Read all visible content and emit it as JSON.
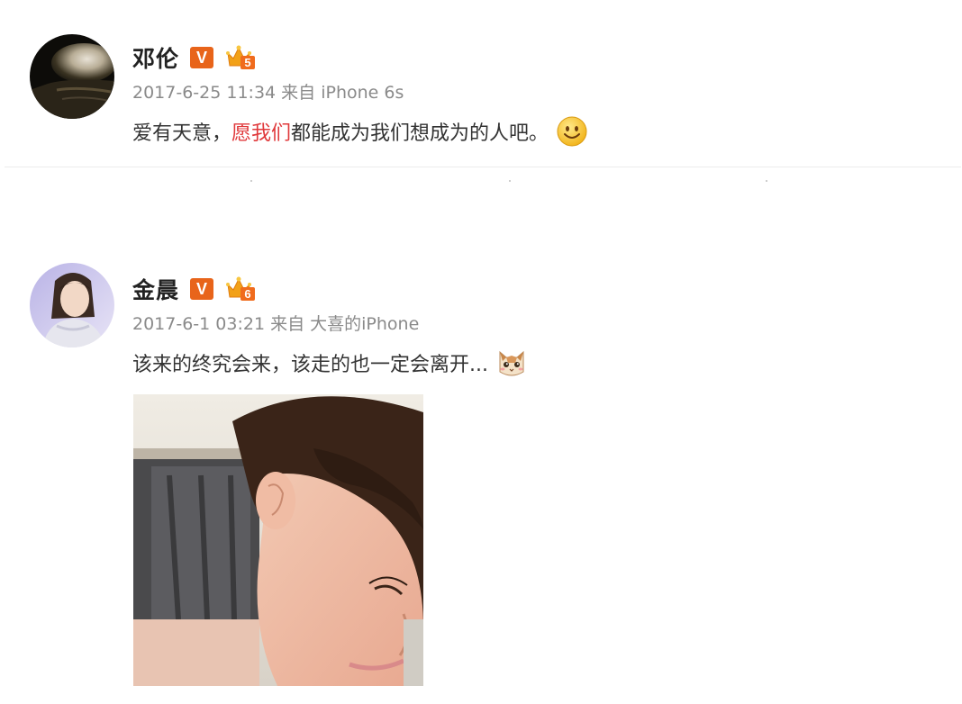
{
  "posts": [
    {
      "username": "邓伦",
      "verified_badge": "V",
      "level_badge_icon": "crown-level-badge",
      "time": "2017-6-25 11:34",
      "source_prefix": "来自",
      "source": "iPhone 6s",
      "text_before": "爱有天意，",
      "text_highlight": "愿我们",
      "text_after": "都能成为我们想成为的人吧。",
      "emoji_icon": "smile-emoji"
    },
    {
      "username": "金晨",
      "verified_badge": "V",
      "level_badge_icon": "crown-level-badge",
      "time": "2017-6-1 03:21",
      "source_prefix": "来自",
      "source": "大喜的iPhone",
      "text": "该来的终究会来，该走的也一定会离开...",
      "emoji_icon": "cat-emoji",
      "photo": "selfie-photo"
    }
  ],
  "colors": {
    "username": "#222222",
    "meta": "#8a8a8a",
    "text": "#333333",
    "highlight": "#e0393b",
    "verified": "#e8641a"
  }
}
